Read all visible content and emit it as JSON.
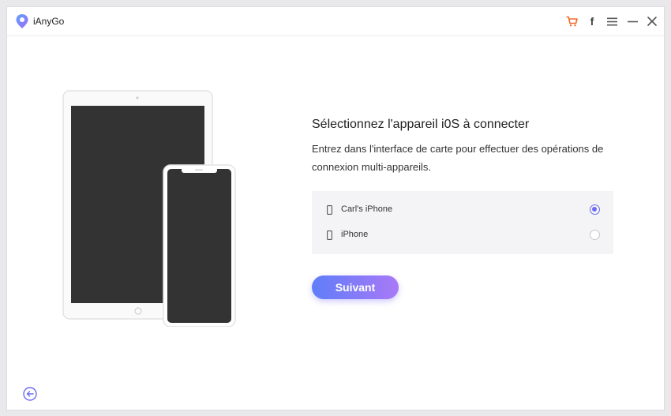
{
  "app": {
    "title": "iAnyGo",
    "brand_color": "#6b6cf1"
  },
  "titlebar": {
    "icons": [
      "cart-icon",
      "facebook-icon",
      "menu-icon",
      "minimize-icon",
      "close-icon"
    ],
    "cart_color": "#f26b2b",
    "facebook_glyph": "f"
  },
  "main": {
    "heading": "Sélectionnez l'appareil i0S à connecter",
    "description": "Entrez dans l'interface de carte pour effectuer des opérations de connexion multi-appareils.",
    "devices": [
      {
        "name": "Carl's iPhone",
        "selected": true
      },
      {
        "name": "iPhone",
        "selected": false
      }
    ],
    "next_label": "Suivant"
  }
}
